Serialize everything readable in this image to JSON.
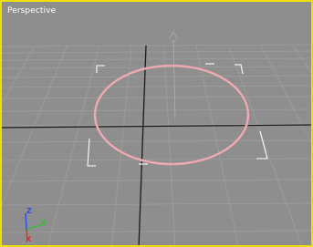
{
  "viewport": {
    "label": "Perspective",
    "border_color": "#f0e000",
    "background_color": "#8e8e8e",
    "grid_color": "#9f9f9f",
    "home_grid_axis_color": "#1a1a1a",
    "selected_object": {
      "type": "circle",
      "color": "#e6a0a8",
      "selection_bracket_color": "#ffffff"
    },
    "gizmo_icon": "move-gizmo-icon",
    "axis_tripod": {
      "x_label": "X",
      "y_label": "Y",
      "z_label": "Z",
      "x_color": "#d83030",
      "y_color": "#30c030",
      "z_color": "#3050e0"
    }
  }
}
